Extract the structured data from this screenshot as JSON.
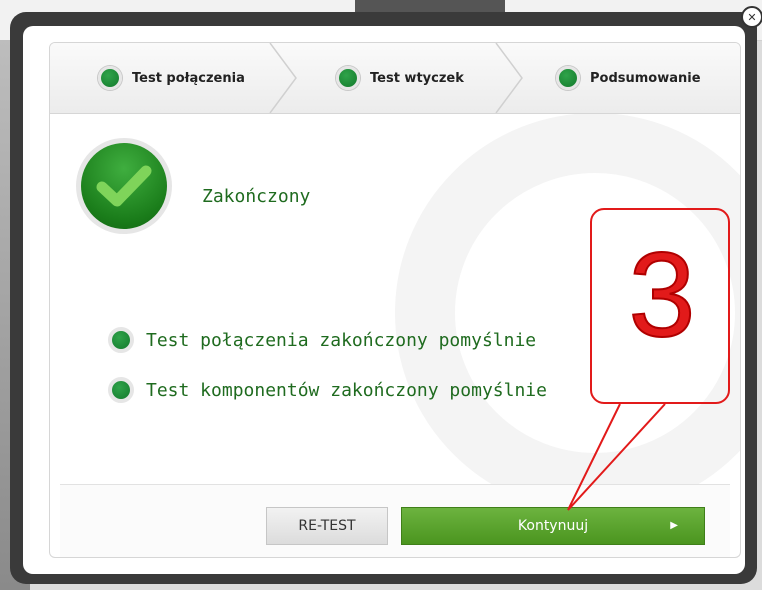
{
  "steps": [
    {
      "label": "Test połączenia"
    },
    {
      "label": "Test wtyczek"
    },
    {
      "label": "Podsumowanie"
    }
  ],
  "status": {
    "title": "Zakończony"
  },
  "results": [
    {
      "text": "Test połączenia zakończony pomyślnie"
    },
    {
      "text": "Test komponentów zakończony pomyślnie"
    }
  ],
  "buttons": {
    "retest": "RE-TEST",
    "continue": "Kontynuuj"
  },
  "annotation": {
    "number": "3"
  },
  "colors": {
    "accent_green": "#4b951f",
    "annotation_red": "#e21a1a"
  },
  "icons": {
    "close": "close-icon",
    "status": "check-icon",
    "arrow": "arrow-right-icon"
  }
}
